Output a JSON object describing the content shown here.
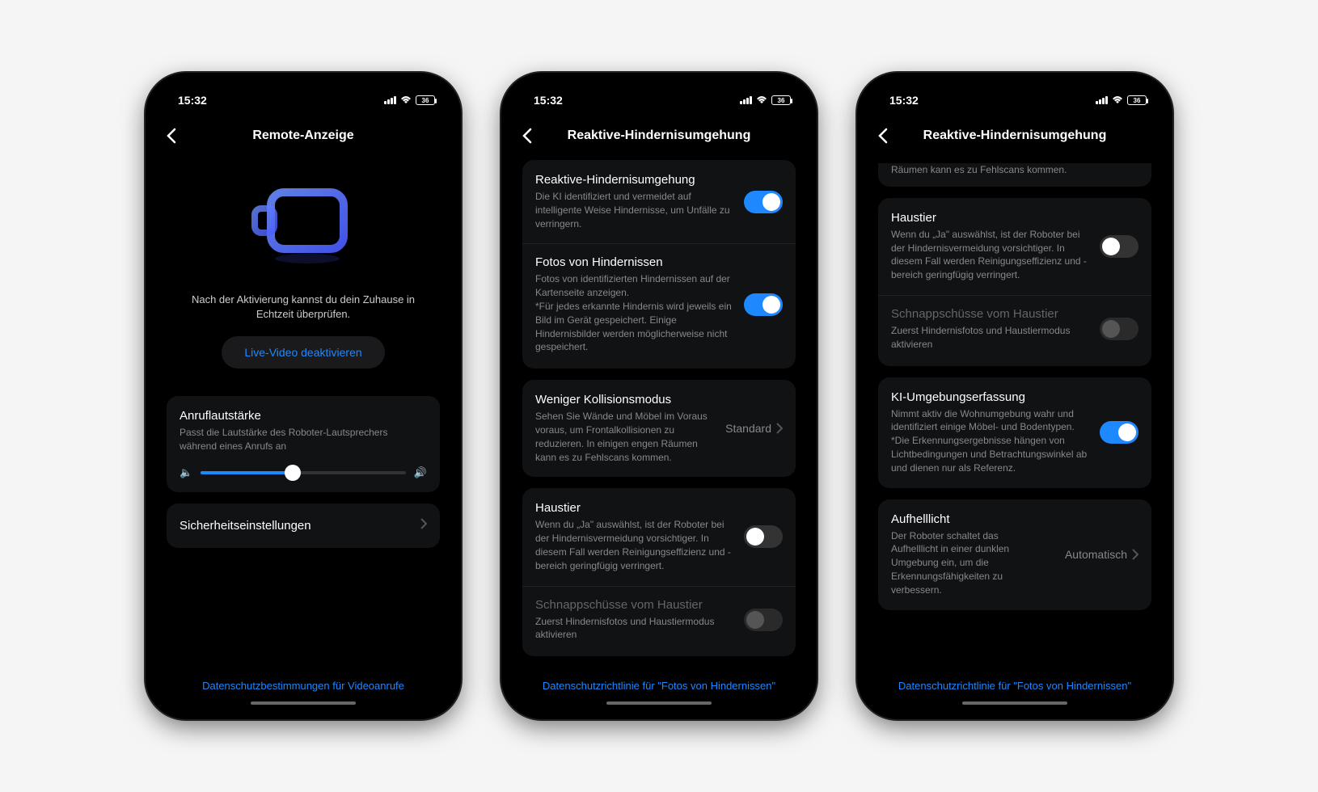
{
  "status": {
    "time": "15:32",
    "battery": "36"
  },
  "phone1": {
    "title": "Remote-Anzeige",
    "hero_desc": "Nach der Aktivierung kannst du dein Zuhause in Echtzeit überprüfen.",
    "primary_btn": "Live-Video deaktivieren",
    "vol_title": "Anruflautstärke",
    "vol_desc": "Passt die Lautstärke des Roboter-Lautsprechers während eines Anrufs an",
    "slider_pct": 45,
    "security_label": "Sicherheitseinstellungen",
    "bottom_link": "Datenschutzbestimmungen für Videoanrufe"
  },
  "phone2": {
    "title": "Reaktive-Hindernisumgehung",
    "reactive_title": "Reaktive-Hindernisumgehung",
    "reactive_desc": "Die KI identifiziert und vermeidet auf intelligente Weise Hindernisse, um Unfälle zu verringern.",
    "photos_title": "Fotos von Hindernissen",
    "photos_desc": "Fotos von identifizierten Hindernissen auf der Kartenseite anzeigen.\n*Für jedes erkannte Hindernis wird jeweils ein Bild im Gerät gespeichert. Einige Hindernisbilder werden möglicherweise nicht gespeichert.",
    "collision_title": "Weniger Kollisionsmodus",
    "collision_desc": "Sehen Sie Wände und Möbel im Voraus voraus, um Frontalkollisionen zu reduzieren. In einigen engen Räumen kann es zu Fehlscans kommen.",
    "collision_value": "Standard",
    "pet_title": "Haustier",
    "pet_desc": "Wenn du „Ja\" auswählst, ist der Roboter bei der Hindernisvermeidung vorsichtiger. In diesem Fall werden Reinigungseffizienz und -bereich geringfügig verringert.",
    "snap_title": "Schnappschüsse vom Haustier",
    "snap_desc": "Zuerst Hindernisfotos und Haustiermodus aktivieren",
    "bottom_link": "Datenschutzrichtlinie für \"Fotos von Hindernissen\""
  },
  "phone3": {
    "title": "Reaktive-Hindernisumgehung",
    "partial_desc": "Räumen kann es zu Fehlscans kommen.",
    "pet_title": "Haustier",
    "pet_desc": "Wenn du „Ja\" auswählst, ist der Roboter bei der Hindernisvermeidung vorsichtiger. In diesem Fall werden Reinigungseffizienz und -bereich geringfügig verringert.",
    "snap_title": "Schnappschüsse vom Haustier",
    "snap_desc": "Zuerst Hindernisfotos und Haustiermodus aktivieren",
    "ai_title": "KI-Umgebungserfassung",
    "ai_desc": "Nimmt aktiv die Wohnumgebung wahr und identifiziert einige Möbel- und Bodentypen. *Die Erkennungsergebnisse hängen von Lichtbedingungen und Betrachtungswinkel ab und dienen nur als Referenz.",
    "light_title": "Aufhelllicht",
    "light_desc": "Der Roboter schaltet das Aufhelllicht in einer dunklen Umgebung ein, um die Erkennungsfähigkeiten zu verbessern.",
    "light_value": "Automatisch",
    "bottom_link": "Datenschutzrichtlinie für \"Fotos von Hindernissen\""
  }
}
